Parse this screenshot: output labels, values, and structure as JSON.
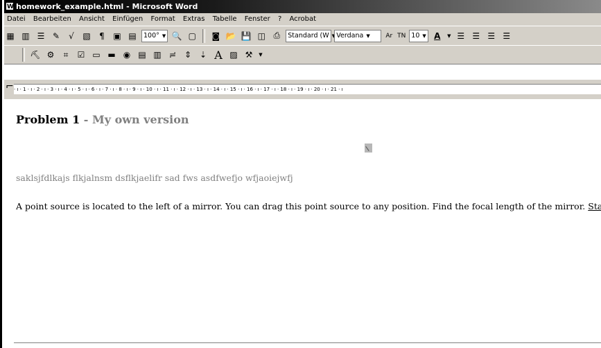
{
  "window": {
    "title": "homework_example.html - Microsoft Word"
  },
  "menubar": {
    "items": [
      "Datei",
      "Bearbeiten",
      "Ansicht",
      "Einfügen",
      "Format",
      "Extras",
      "Tabelle",
      "Fenster",
      "?",
      "Acrobat"
    ]
  },
  "toolbar": {
    "zoom": "100°",
    "style": "Standard (W",
    "font": "Verdana",
    "size": "10",
    "tn_label": "TN",
    "ar_label": "Ar"
  },
  "ruler": {
    "ticks": "· ı · 1 · ı · 2 · ı · 3 · ı · 4 · ı · 5 · ı · 6 · ı · 7 · ı · 8 · ı · 9 · ı · 10 · ı · 11 · ı · 12 · ı · 13 · ı · 14 · ı · 15 · ı · 16 · ı · 17 · ı · 18 · ı · 19 · ı · 20 · ı · 21 · ı"
  },
  "document": {
    "heading_bold": "Problem 1",
    "heading_gray": " - My own version",
    "gibberish": "saklsjfdlkajs  flkjalnsm  dsflkjaelifr sad fws asdfwefjo  wfjaoiejwfj",
    "body": "A point source is located to the left of a mirror.  You can drag this point source to any position.  Find the focal length of the mirror.  ",
    "link": "Start"
  }
}
